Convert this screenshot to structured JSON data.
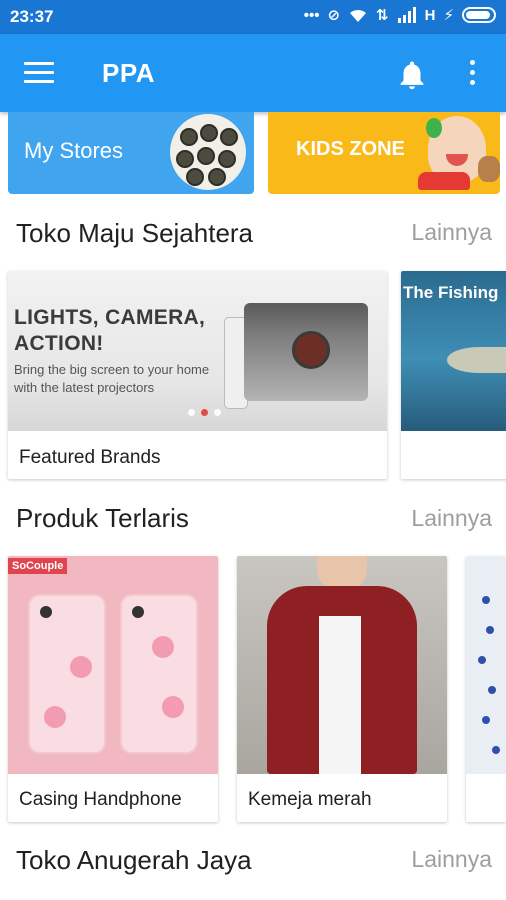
{
  "status_bar": {
    "time": "23:37",
    "network_label": "H",
    "icons": [
      "dots-icon",
      "sync-off-icon",
      "wifi-icon",
      "data-transfer-icon",
      "signal-icon",
      "charging-icon",
      "battery-icon"
    ]
  },
  "app_bar": {
    "title": "PPA",
    "icons": [
      "menu-icon",
      "notification-bell-icon",
      "more-vert-icon"
    ]
  },
  "promos": [
    {
      "label": "My Stores",
      "color": "#41a4ee"
    },
    {
      "label": "KIDS ZONE",
      "color": "#f9ba19"
    }
  ],
  "sections": [
    {
      "title": "Toko Maju Sejahtera",
      "more": "Lainnya",
      "cards": [
        {
          "label": "Featured Brands",
          "banner": {
            "headline": "LIGHTS, CAMERA, ACTION!",
            "subline": "Bring the big screen to your home with the latest projectors"
          }
        },
        {
          "label": "",
          "banner": {
            "headline": "The Fishing"
          }
        }
      ]
    },
    {
      "title": "Produk Terlaris",
      "more": "Lainnya",
      "cards": [
        {
          "label": "Casing Handphone",
          "badge": "SoCouple"
        },
        {
          "label": "Kemeja merah"
        },
        {
          "label": ""
        }
      ]
    },
    {
      "title": "Toko Anugerah Jaya",
      "more": "Lainnya"
    }
  ],
  "colors": {
    "status_bar": "#1976d2",
    "app_bar": "#2196f3",
    "text_primary": "#212121",
    "text_secondary": "#9e9e9e"
  }
}
